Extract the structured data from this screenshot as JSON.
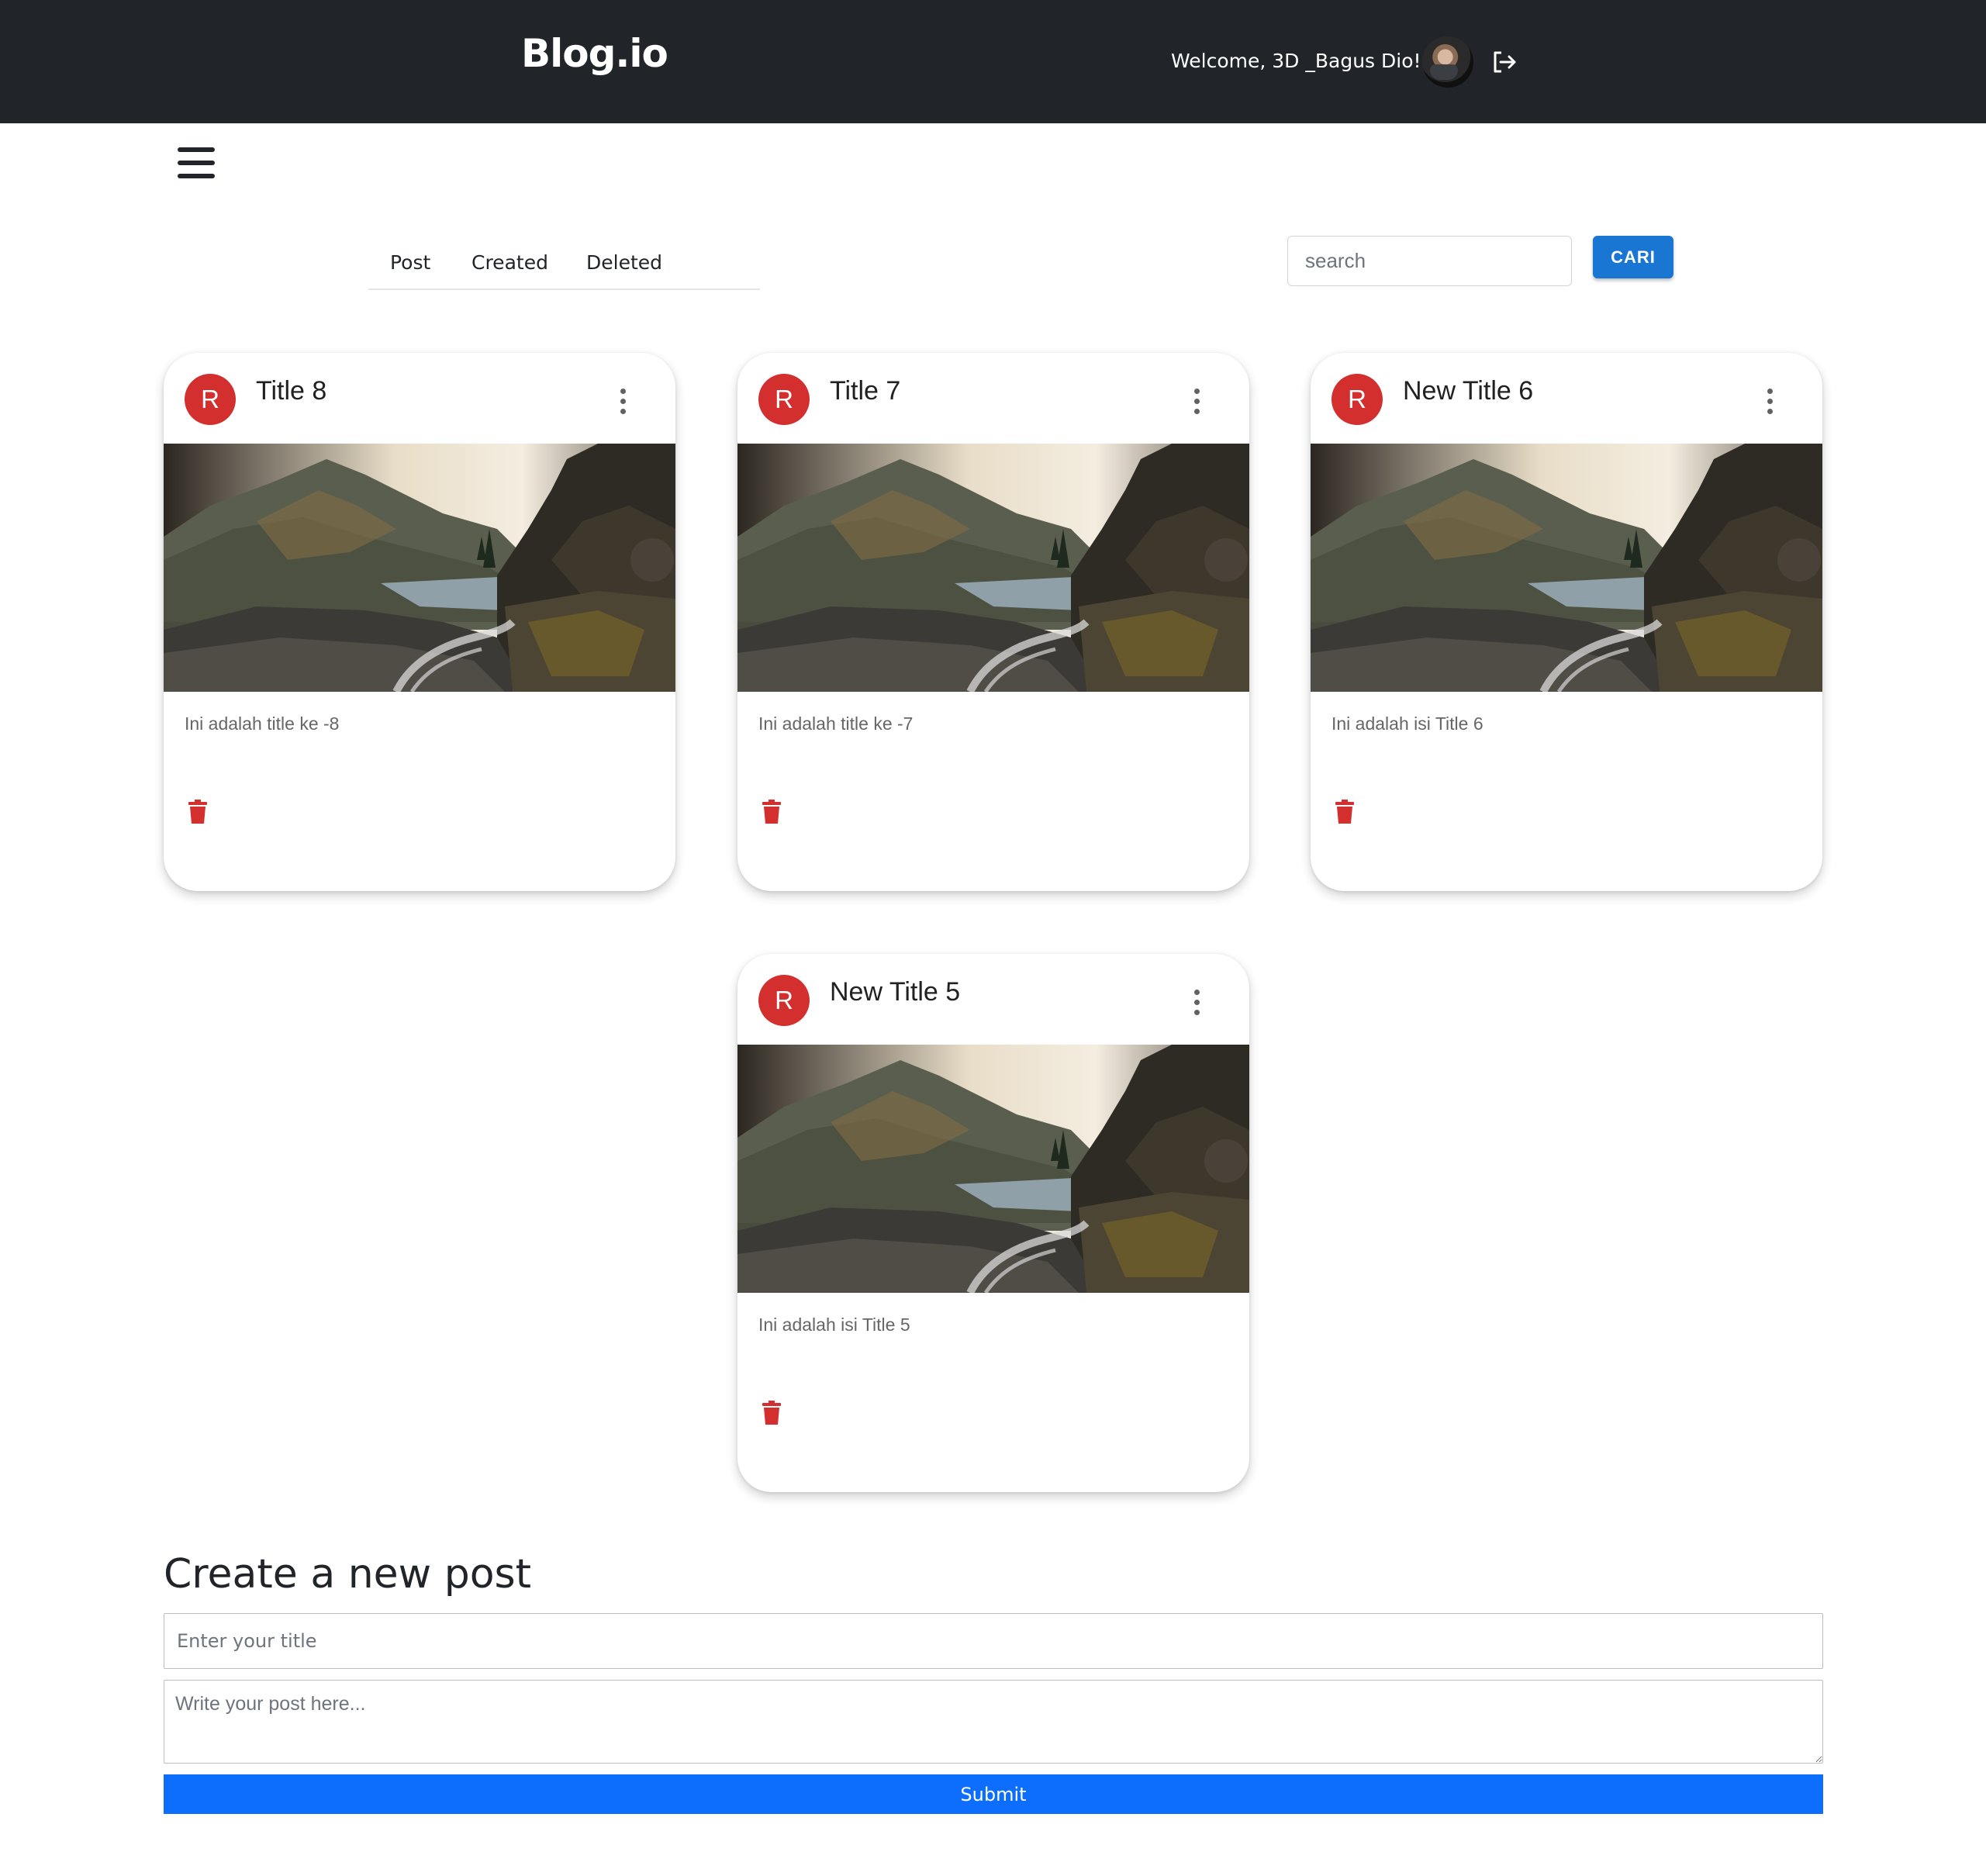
{
  "header": {
    "brand": "Blog.io",
    "welcome": "Welcome, 3D _Bagus Dio!",
    "logout_icon": "logout-icon",
    "background": "#212529"
  },
  "tabs": [
    {
      "label": "Post"
    },
    {
      "label": "Created"
    },
    {
      "label": "Deleted"
    }
  ],
  "search": {
    "placeholder": "search",
    "button_label": "CARI",
    "button_color": "#1976d2"
  },
  "posts": [
    {
      "avatar": "R",
      "title": "Title 8",
      "body": "Ini adalah title ke -8",
      "image": "mountain-lake-landscape"
    },
    {
      "avatar": "R",
      "title": "Title 7",
      "body": "Ini adalah title ke -7",
      "image": "mountain-lake-landscape"
    },
    {
      "avatar": "R",
      "title": "New Title 6",
      "body": "Ini adalah isi Title 6",
      "image": "mountain-lake-landscape"
    },
    {
      "avatar": "R",
      "title": "New Title 5",
      "body": "Ini adalah isi Title 5",
      "image": "mountain-lake-landscape"
    }
  ],
  "card_colors": {
    "avatar_bg": "#d32f2f",
    "delete_icon": "#d32f2f"
  },
  "create": {
    "heading": "Create a new post",
    "title_placeholder": "Enter your title",
    "body_placeholder": "Write your post here...",
    "submit_label": "Submit",
    "submit_color": "#0d6efd"
  }
}
